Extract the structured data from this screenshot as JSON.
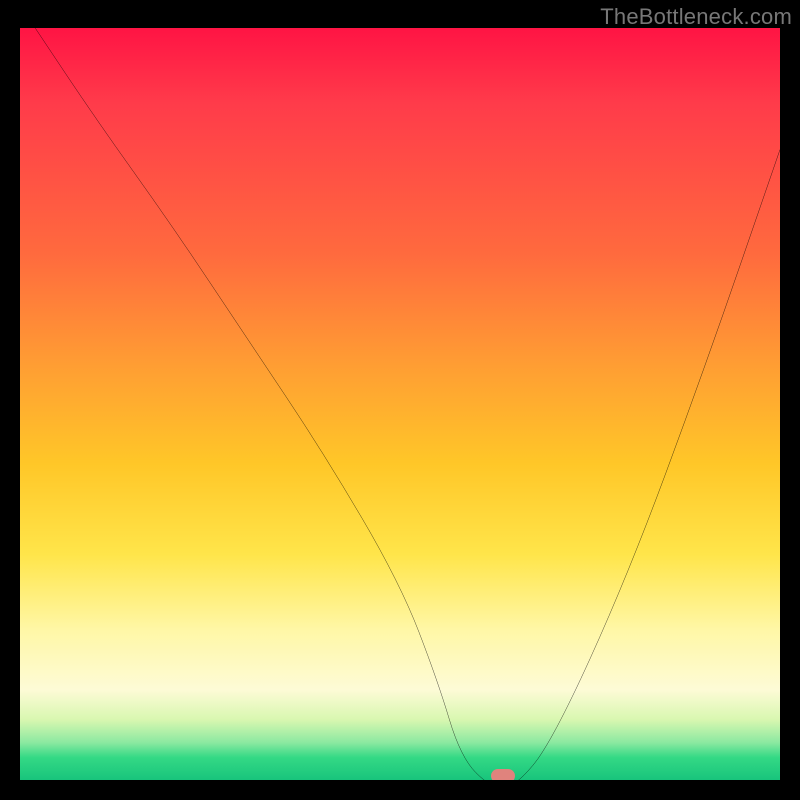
{
  "watermark": "TheBottleneck.com",
  "chart_data": {
    "type": "line",
    "title": "",
    "xlabel": "",
    "ylabel": "",
    "xlim": [
      0,
      100
    ],
    "ylim": [
      0,
      100
    ],
    "series": [
      {
        "name": "curve",
        "x": [
          2,
          10,
          20,
          30,
          40,
          50,
          55,
          58,
          62,
          65,
          70,
          80,
          90,
          100
        ],
        "y": [
          100,
          88,
          74,
          59,
          44,
          27,
          14,
          4,
          0,
          0,
          6,
          28,
          55,
          84
        ]
      }
    ],
    "marker": {
      "x": 63.5,
      "y": 0.5,
      "color": "#e0837d"
    },
    "gradient_stops": [
      {
        "pos": 0,
        "color": "#ff1444"
      },
      {
        "pos": 30,
        "color": "#ff6a3e"
      },
      {
        "pos": 58,
        "color": "#ffc728"
      },
      {
        "pos": 80,
        "color": "#fff7a6"
      },
      {
        "pos": 95,
        "color": "#8ce9a1"
      },
      {
        "pos": 100,
        "color": "#18c47c"
      }
    ]
  }
}
